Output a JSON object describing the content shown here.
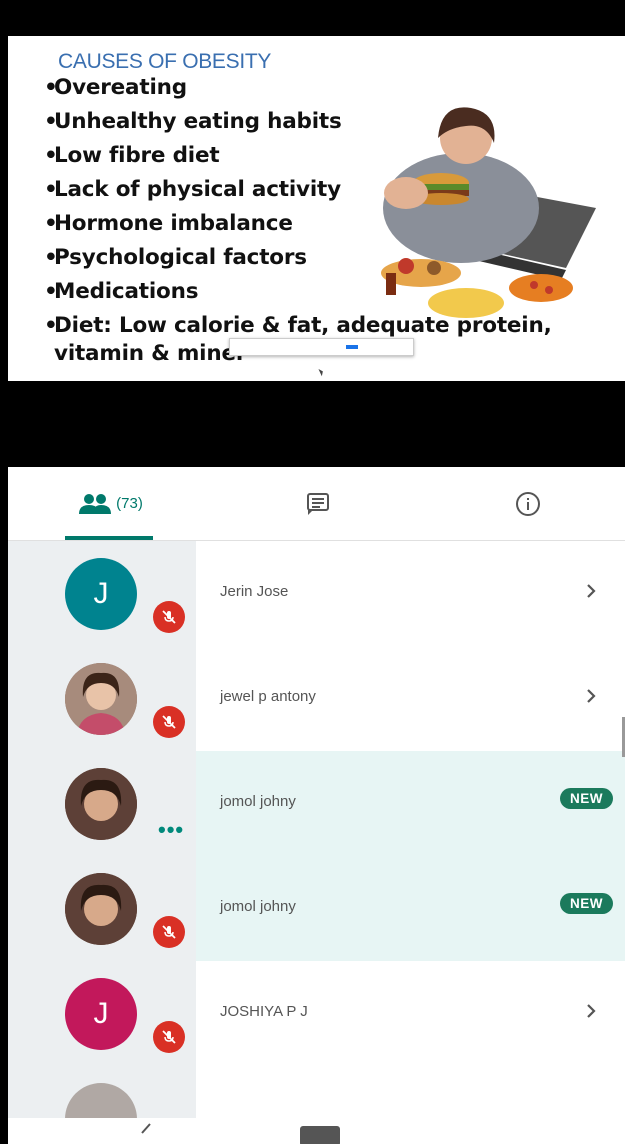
{
  "slide": {
    "title": "CAUSES OF OBESITY",
    "bullets": [
      "Overeating",
      "Unhealthy eating habits",
      "Low fibre diet",
      "Lack of physical activity",
      "Hormone imbalance",
      "Psychological factors",
      "Medications"
    ],
    "last_bullet_line1": "Diet: Low calorie & fat, adequate protein,",
    "last_bullet_line2": "vitamin & miner"
  },
  "tabs": {
    "people_count": "(73)",
    "people_icon": "people-icon",
    "chat_icon": "chat-icon",
    "info_icon": "info-icon",
    "accent": "#00796b"
  },
  "participants": [
    {
      "name": "Jerin Jose",
      "initial": "J",
      "avatar_color": "#00838f",
      "muted": true,
      "badge": "",
      "highlight": false
    },
    {
      "name": "jewel p antony",
      "initial": "",
      "avatar_color": "#8d6e63",
      "muted": true,
      "badge": "",
      "highlight": false
    },
    {
      "name": "jomol johny",
      "initial": "",
      "avatar_color": "#6d4c41",
      "muted": false,
      "badge": "NEW",
      "highlight": true
    },
    {
      "name": "jomol johny",
      "initial": "",
      "avatar_color": "#6d4c41",
      "muted": true,
      "badge": "NEW",
      "highlight": true
    },
    {
      "name": "JOSHIYA P J",
      "initial": "J",
      "avatar_color": "#c2185b",
      "muted": true,
      "badge": "",
      "highlight": false
    }
  ],
  "colors": {
    "mute_red": "#d93025",
    "new_badge": "#1b7a5c",
    "highlight_row": "#e7f5f4"
  }
}
